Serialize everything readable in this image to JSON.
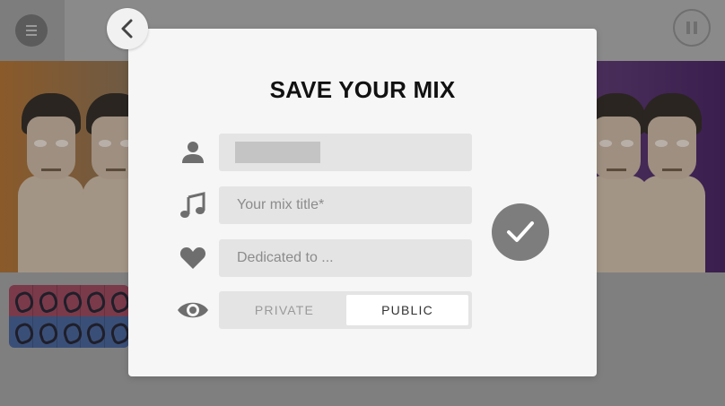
{
  "dialog": {
    "title": "SAVE YOUR MIX",
    "fields": {
      "name": {
        "value": ""
      },
      "mix_title": {
        "placeholder": "Your mix title*",
        "value": ""
      },
      "dedicated_to": {
        "placeholder": "Dedicated to ...",
        "value": ""
      }
    },
    "visibility": {
      "options": [
        "PRIVATE",
        "PUBLIC"
      ],
      "selected": "PUBLIC"
    }
  },
  "icons": {
    "menu": "hamburger-menu-icon",
    "pause": "pause-icon",
    "back": "chevron-left-icon",
    "user": "user-icon",
    "music": "music-note-icon",
    "heart": "heart-icon",
    "eye": "eye-icon",
    "confirm": "checkmark-icon"
  },
  "colors": {
    "modal_bg": "#f6f6f6",
    "field_bg": "#e4e4e4",
    "icon_gray": "#6e6e6e",
    "confirm_bg": "#7d7d7d",
    "title_text": "#111111"
  }
}
